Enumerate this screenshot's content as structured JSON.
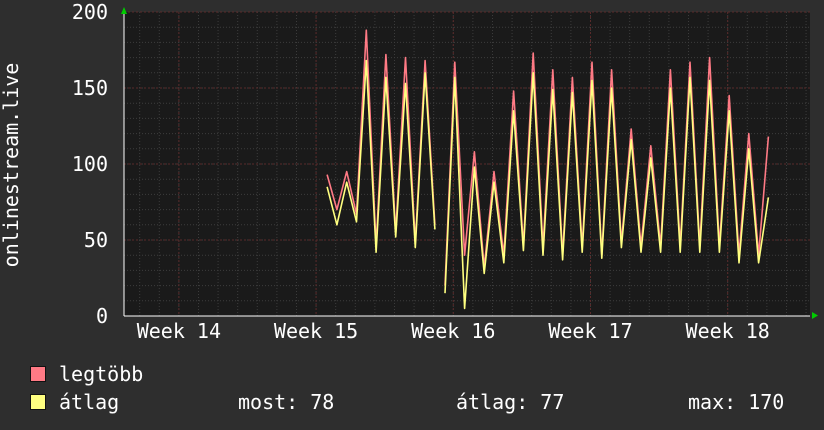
{
  "chart_data": {
    "type": "line",
    "ylabel": "onlinestream.live",
    "ylim": [
      0,
      200
    ],
    "yticks": [
      0,
      50,
      100,
      150,
      200
    ],
    "xlim": [
      13.6,
      18.6
    ],
    "xticks": [
      {
        "value": 14,
        "label": "Week 14"
      },
      {
        "value": 15,
        "label": "Week 15"
      },
      {
        "value": 16,
        "label": "Week 16"
      },
      {
        "value": 17,
        "label": "Week 17"
      },
      {
        "value": 18,
        "label": "Week 18"
      }
    ],
    "grid": true,
    "series": [
      {
        "name": "legtöbb",
        "color": "#ff7a85",
        "segments": [
          {
            "start": 15.08,
            "step": 0.0714286,
            "values": [
              93,
              70,
              95,
              67,
              188,
              46,
              172,
              55,
              170,
              48,
              168,
              60
            ]
          },
          {
            "start": 15.94,
            "step": 0.0714286,
            "values": [
              20,
              167,
              40,
              108,
              32,
              95,
              40,
              148,
              46,
              173,
              45,
              162,
              40,
              157,
              45,
              167,
              40,
              162,
              48,
              123,
              46,
              112,
              46,
              162,
              46,
              167,
              46,
              170,
              46,
              145,
              40,
              120,
              40,
              118
            ]
          }
        ]
      },
      {
        "name": "átlag",
        "color": "#ffff80",
        "segments": [
          {
            "start": 15.08,
            "step": 0.0714286,
            "values": [
              85,
              60,
              88,
              62,
              168,
              42,
              157,
              52,
              153,
              45,
              160,
              57
            ]
          },
          {
            "start": 15.94,
            "step": 0.0714286,
            "values": [
              15,
              157,
              5,
              98,
              28,
              88,
              35,
              135,
              43,
              160,
              40,
              149,
              37,
              147,
              42,
              155,
              38,
              150,
              45,
              116,
              42,
              104,
              42,
              150,
              42,
              157,
              42,
              155,
              42,
              135,
              35,
              110,
              35,
              78
            ]
          }
        ]
      }
    ]
  },
  "legend": [
    {
      "label": "legtöbb",
      "color": "#ff7a85"
    },
    {
      "label": "átlag",
      "color": "#ffff80"
    }
  ],
  "stats": {
    "now": "most: 78",
    "avg": "átlag: 77",
    "max": "max: 170"
  },
  "colors": {
    "background": "#2e2e2e",
    "plot_background": "#1a1a1a",
    "grid_minor": "#3c3c3c",
    "grid_major": "#5a2a2a",
    "axis": "#ffffff",
    "arrow": "#00cc00"
  }
}
